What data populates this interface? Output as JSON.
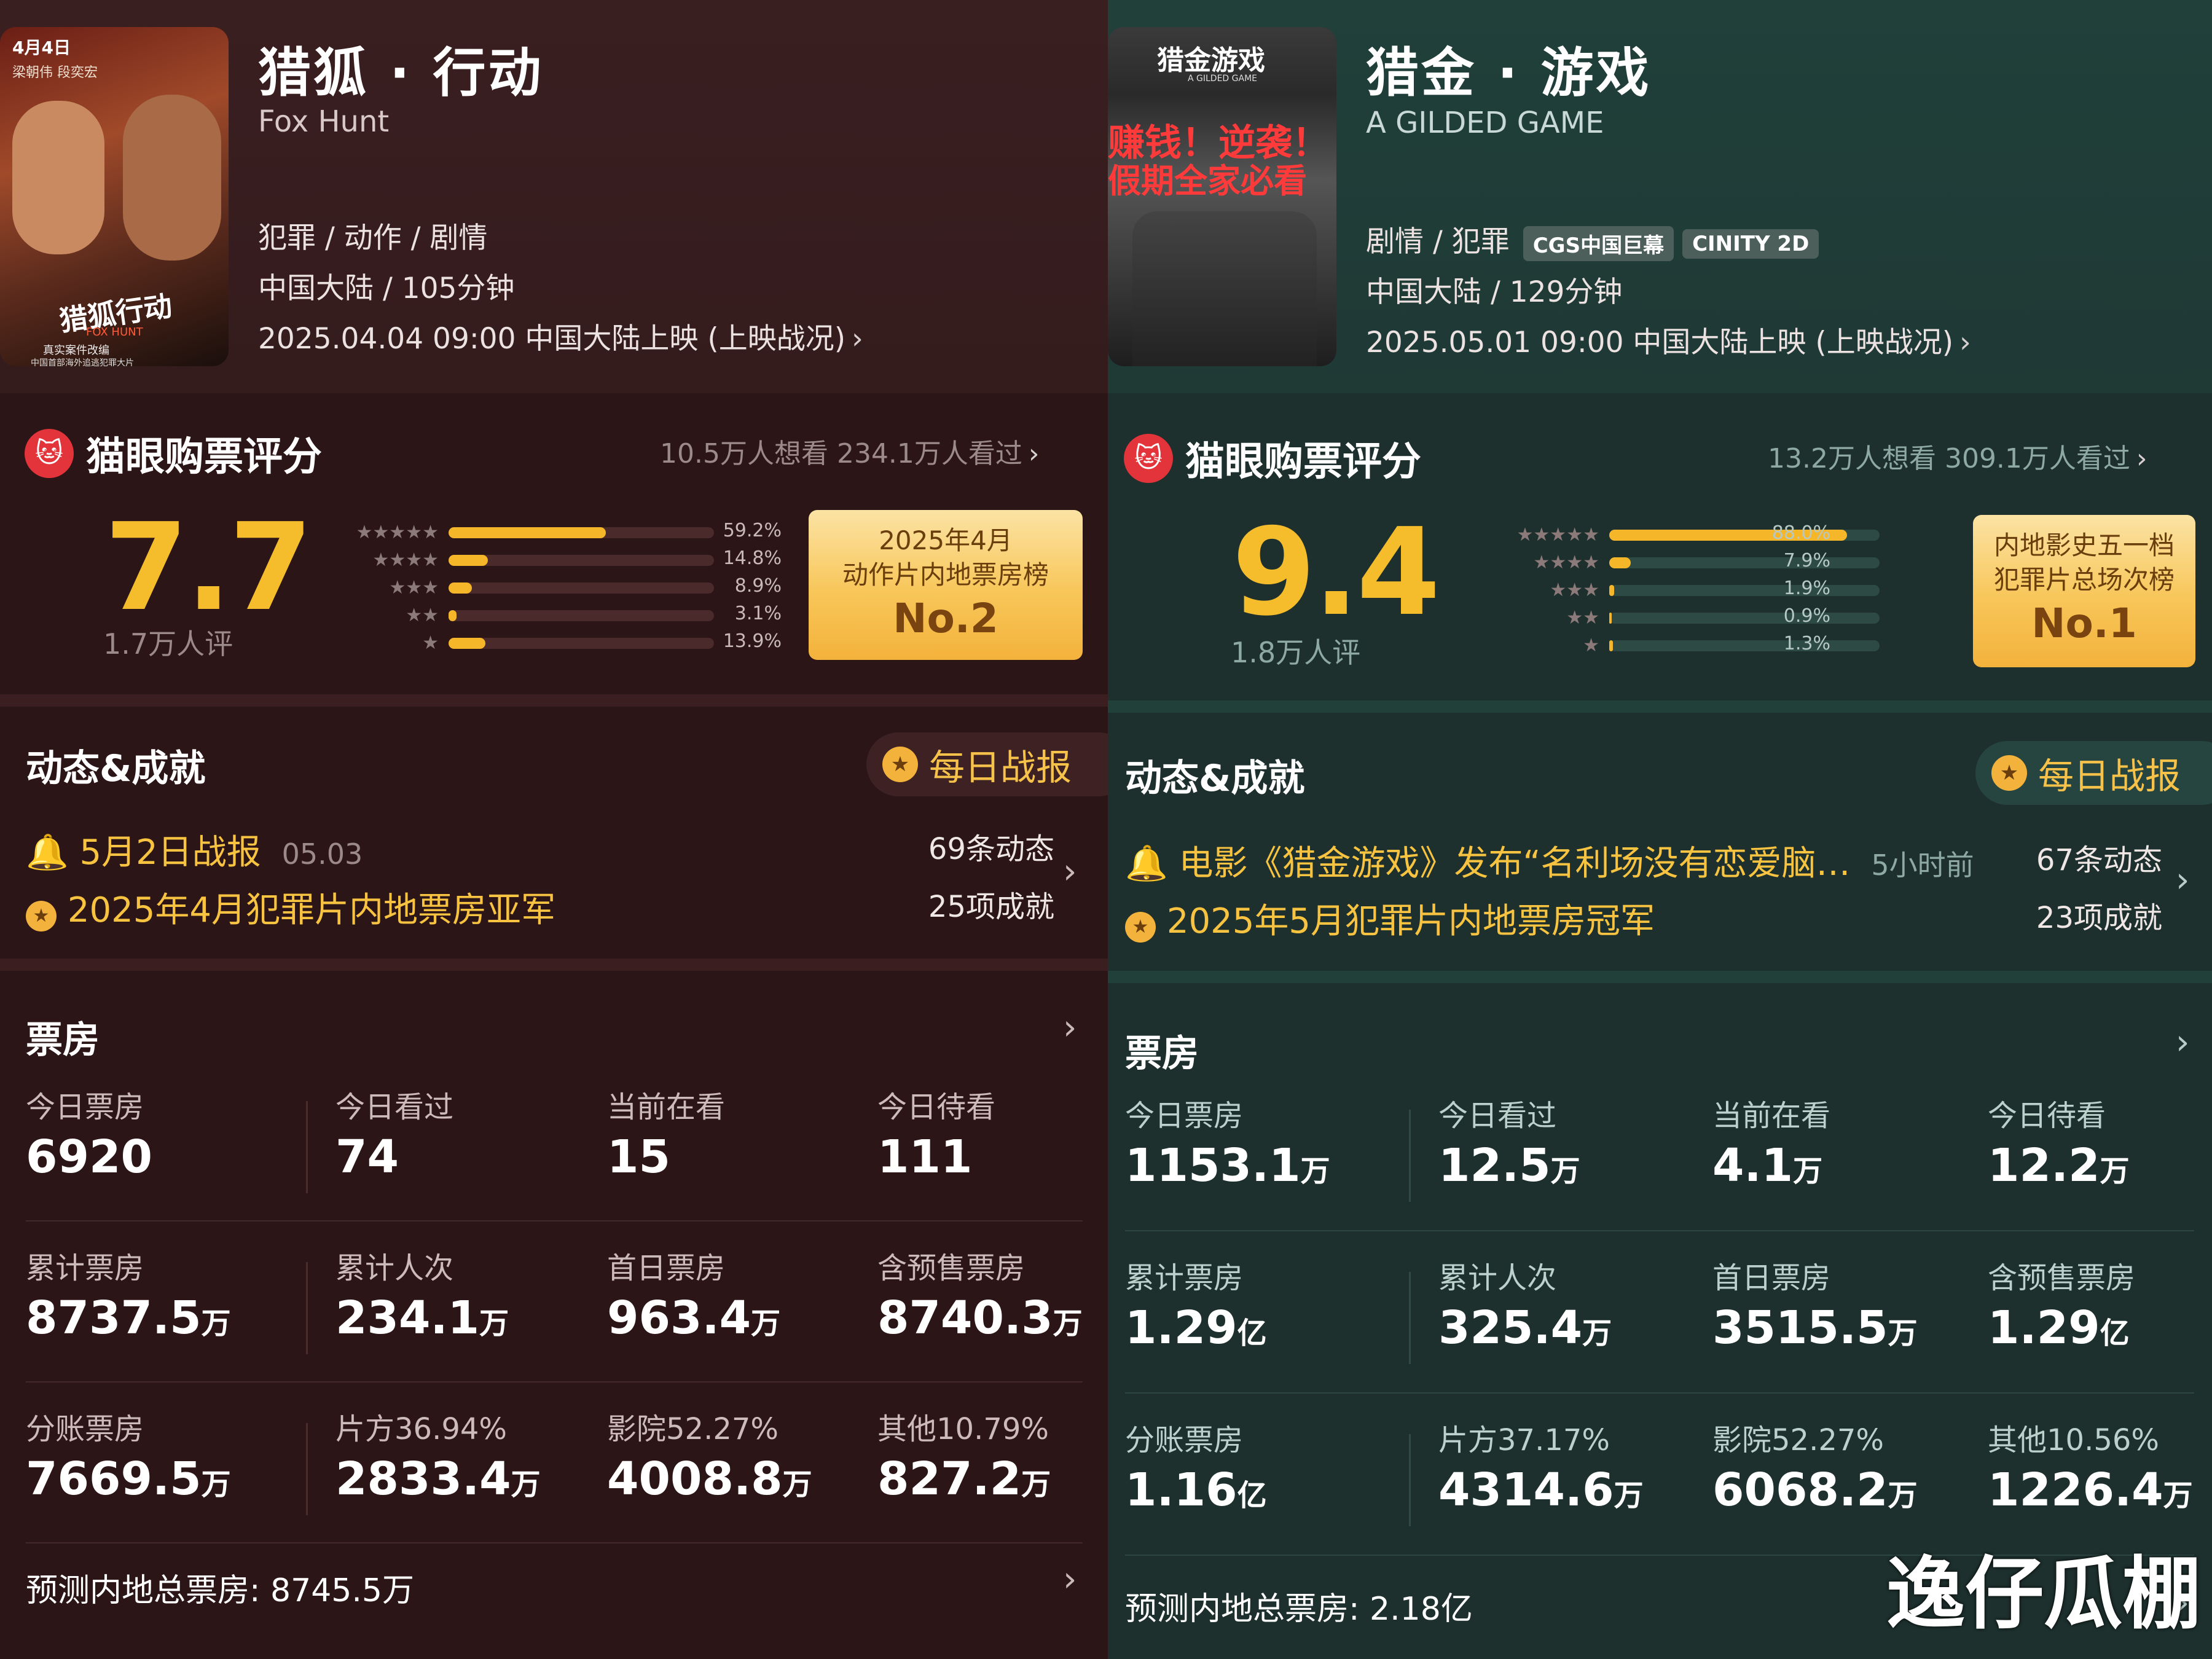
{
  "left": {
    "poster_text": {
      "date": "4月4日",
      "names": "梁朝伟 段奕宏",
      "title": "猎狐行动",
      "sub": "FOX HUNT",
      "caption1": "真实案件改编",
      "caption2": "中国首部海外追逃犯罪大片"
    },
    "title": "猎狐 · 行动",
    "english_title": "Fox Hunt",
    "genre": "犯罪 / 动作 / 剧情",
    "region_duration": "中国大陆 / 105分钟",
    "release": "2025.04.04 09:00 中国大陆上映 (上映战况)",
    "rating_title": "猫眼购票评分",
    "want_watched": "10.5万人想看  234.1万人看过",
    "score": "7.7",
    "raters": "1.7万人评",
    "distribution": [
      {
        "stars": "★★★★★",
        "pct": "59.2%",
        "value": 59.2
      },
      {
        "stars": "★★★★",
        "pct": "14.8%",
        "value": 14.8
      },
      {
        "stars": "★★★",
        "pct": "8.9%",
        "value": 8.9
      },
      {
        "stars": "★★",
        "pct": "3.1%",
        "value": 3.1
      },
      {
        "stars": "★",
        "pct": "13.9%",
        "value": 13.9
      }
    ],
    "badge_line1": "2025年4月",
    "badge_line2": "动作片内地票房榜",
    "badge_rank": "No.2",
    "dyn_title": "动态&成就",
    "daily_report": "每日战报",
    "news1": "5月2日战报",
    "news1_date": "05.03",
    "news2": "2025年4月犯罪片内地票房亚军",
    "dyn_count": "69条动态",
    "ach_count": "25项成就",
    "bo_title": "票房",
    "rows": [
      [
        {
          "label": "今日票房",
          "value": "6920",
          "unit": ""
        },
        {
          "label": "今日看过",
          "value": "74",
          "unit": ""
        },
        {
          "label": "当前在看",
          "value": "15",
          "unit": ""
        },
        {
          "label": "今日待看",
          "value": "111",
          "unit": ""
        }
      ],
      [
        {
          "label": "累计票房",
          "value": "8737.5",
          "unit": "万"
        },
        {
          "label": "累计人次",
          "value": "234.1",
          "unit": "万"
        },
        {
          "label": "首日票房",
          "value": "963.4",
          "unit": "万"
        },
        {
          "label": "含预售票房",
          "value": "8740.3",
          "unit": "万"
        }
      ],
      [
        {
          "label": "分账票房",
          "value": "7669.5",
          "unit": "万"
        },
        {
          "label": "片方36.94%",
          "value": "2833.4",
          "unit": "万"
        },
        {
          "label": "影院52.27%",
          "value": "4008.8",
          "unit": "万"
        },
        {
          "label": "其他10.79%",
          "value": "827.2",
          "unit": "万"
        }
      ]
    ],
    "forecast": "预测内地总票房:  8745.5万"
  },
  "right": {
    "poster_text": {
      "title": "猎金游戏",
      "sub": "A GILDED GAME",
      "slogan1": "赚钱！逆袭！",
      "slogan2": "假期全家必看"
    },
    "title": "猎金 · 游戏",
    "english_title": "A GILDED GAME",
    "genre": "剧情 / 犯罪",
    "tag1": "CGS中国巨幕",
    "tag2": "CINITY 2D",
    "region_duration": "中国大陆 / 129分钟",
    "release": "2025.05.01 09:00 中国大陆上映 (上映战况)",
    "rating_title": "猫眼购票评分",
    "want_watched": "13.2万人想看  309.1万人看过",
    "score": "9.4",
    "raters": "1.8万人评",
    "distribution": [
      {
        "stars": "★★★★★",
        "pct": "88.0%",
        "value": 88.0
      },
      {
        "stars": "★★★★",
        "pct": "7.9%",
        "value": 7.9
      },
      {
        "stars": "★★★",
        "pct": "1.9%",
        "value": 1.9
      },
      {
        "stars": "★★",
        "pct": "0.9%",
        "value": 0.9
      },
      {
        "stars": "★",
        "pct": "1.3%",
        "value": 1.3
      }
    ],
    "badge_line1": "内地影史五一档",
    "badge_line2": "犯罪片总场次榜",
    "badge_rank": "No.1",
    "dyn_title": "动态&成就",
    "daily_report": "每日战报",
    "news1": "电影《猎金游戏》发布“名利场没有恋爱脑…",
    "news1_date": "5小时前",
    "news2": "2025年5月犯罪片内地票房冠军",
    "dyn_count": "67条动态",
    "ach_count": "23项成就",
    "bo_title": "票房",
    "rows": [
      [
        {
          "label": "今日票房",
          "value": "1153.1",
          "unit": "万"
        },
        {
          "label": "今日看过",
          "value": "12.5",
          "unit": "万"
        },
        {
          "label": "当前在看",
          "value": "4.1",
          "unit": "万"
        },
        {
          "label": "今日待看",
          "value": "12.2",
          "unit": "万"
        }
      ],
      [
        {
          "label": "累计票房",
          "value": "1.29",
          "unit": "亿"
        },
        {
          "label": "累计人次",
          "value": "325.4",
          "unit": "万"
        },
        {
          "label": "首日票房",
          "value": "3515.5",
          "unit": "万"
        },
        {
          "label": "含预售票房",
          "value": "1.29",
          "unit": "亿"
        }
      ],
      [
        {
          "label": "分账票房",
          "value": "1.16",
          "unit": "亿"
        },
        {
          "label": "片方37.17%",
          "value": "4314.6",
          "unit": "万"
        },
        {
          "label": "影院52.27%",
          "value": "6068.2",
          "unit": "万"
        },
        {
          "label": "其他10.56%",
          "value": "1226.4",
          "unit": "万"
        }
      ]
    ],
    "forecast": "预测内地总票房:  2.18亿"
  },
  "watermark": "逸仔瓜棚",
  "colors": {
    "accent": "#f5bd2b",
    "left_bg": "#2c1516",
    "right_bg": "#1c312d"
  },
  "icons": [
    "cat-logo-icon",
    "medal-icon",
    "bell-icon",
    "chevron-right-icon",
    "star-icon"
  ]
}
